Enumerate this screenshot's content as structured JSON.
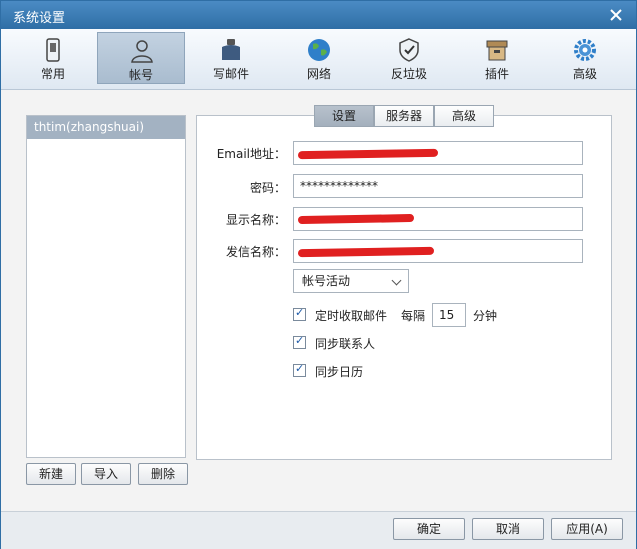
{
  "window": {
    "title": "系统设置"
  },
  "toolbar": {
    "items": [
      {
        "label": "常用",
        "icon": "phone-icon"
      },
      {
        "label": "帐号",
        "icon": "user-icon"
      },
      {
        "label": "写邮件",
        "icon": "ink-bottle-icon"
      },
      {
        "label": "网络",
        "icon": "globe-icon"
      },
      {
        "label": "反垃圾",
        "icon": "shield-icon"
      },
      {
        "label": "插件",
        "icon": "box-icon"
      },
      {
        "label": "高级",
        "icon": "gear-icon"
      }
    ],
    "active": "帐号"
  },
  "accounts": {
    "items": [
      "thtim(zhangshuai)"
    ],
    "buttons": {
      "new": "新建",
      "import": "导入",
      "delete": "删除"
    }
  },
  "tabs": {
    "settings": "设置",
    "server": "服务器",
    "advanced": "高级"
  },
  "form": {
    "email_label": "Email地址：",
    "password_label": "密码：",
    "password_value": "*************",
    "display_label": "显示名称：",
    "sender_label": "发信名称：",
    "account_status": "帐号活动",
    "check_mail_label": "定时收取邮件",
    "every_label": "每隔",
    "interval_value": "15",
    "minutes_label": "分钟",
    "sync_contacts_label": "同步联系人",
    "sync_calendar_label": "同步日历"
  },
  "footer": {
    "ok": "确定",
    "cancel": "取消",
    "apply": "应用(A)"
  },
  "colors": {
    "titlebar": "#2f6ea5",
    "accent": "#1d5aa8",
    "redact": "#e02020"
  }
}
